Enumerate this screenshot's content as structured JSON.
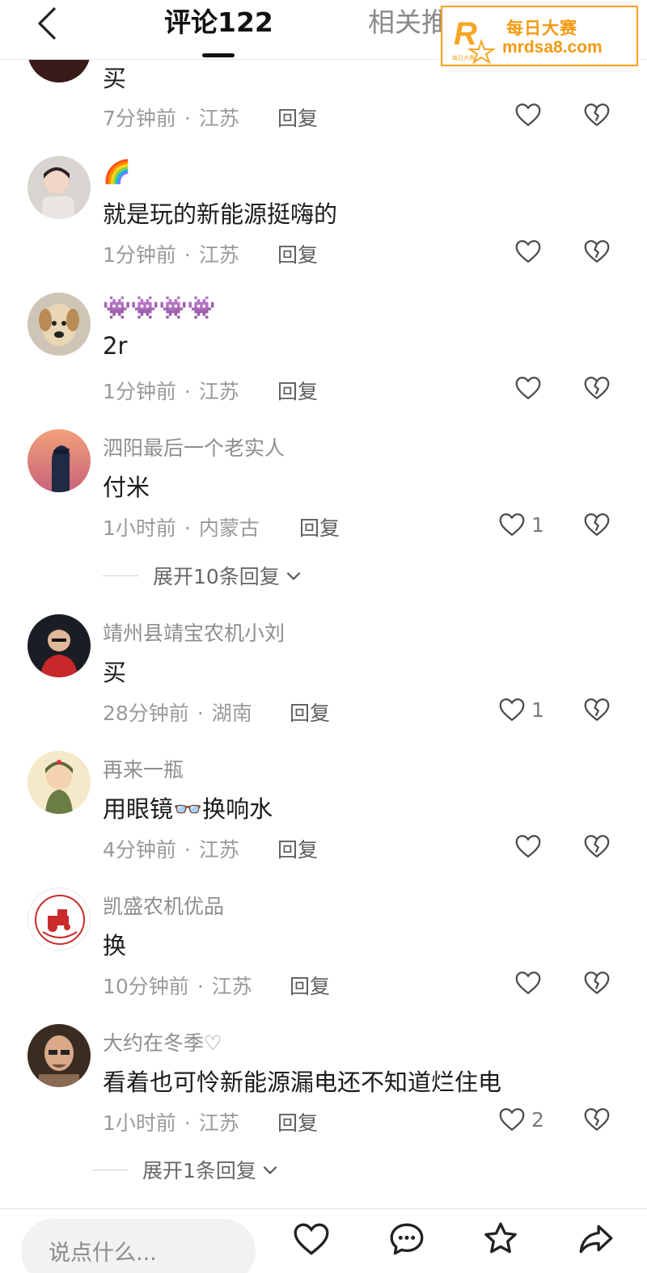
{
  "header": {
    "back_icon": "chevron-left-icon",
    "tab_comments": "评论122",
    "tab_related": "相关推荐"
  },
  "watermark": {
    "cn": "每日大赛",
    "url": "mrdsa8.com",
    "logo_letter": "R",
    "logo_small": "每日大赛",
    "color": "#f39a12"
  },
  "comments": [
    {
      "name": "",
      "text": "买",
      "time": "7分钟前",
      "location": "江苏",
      "reply": "回复",
      "likes": ""
    },
    {
      "name": "🌈",
      "text": "就是玩的新能源挺嗨的",
      "time": "1分钟前",
      "location": "江苏",
      "reply": "回复",
      "likes": ""
    },
    {
      "name": "👾👾👾👾",
      "text": "2r",
      "time": "1分钟前",
      "location": "江苏",
      "reply": "回复",
      "likes": ""
    },
    {
      "name": "泗阳最后一个老实人",
      "text": "付米",
      "time": "1小时前",
      "location": "内蒙古",
      "reply": "回复",
      "likes": "1",
      "expand": "展开10条回复"
    },
    {
      "name": "靖州县靖宝农机小刘",
      "text": "买",
      "time": "28分钟前",
      "location": "湖南",
      "reply": "回复",
      "likes": "1"
    },
    {
      "name": "再来一瓶",
      "text": "用眼镜👓换响水",
      "time": "4分钟前",
      "location": "江苏",
      "reply": "回复",
      "likes": ""
    },
    {
      "name": "凯盛农机优品",
      "text": "换",
      "time": "10分钟前",
      "location": "江苏",
      "reply": "回复",
      "likes": ""
    },
    {
      "name": "大约在冬季♡",
      "text": "看着也可怜新能源漏电还不知道烂住电",
      "time": "1小时前",
      "location": "江苏",
      "reply": "回复",
      "likes": "2",
      "expand": "展开1条回复"
    }
  ],
  "bottom_bar": {
    "placeholder": "说点什么...",
    "icons": [
      "heart-icon",
      "comment-icon",
      "star-icon",
      "share-icon"
    ]
  },
  "colors": {
    "accent": "#f39a12",
    "text": "#1b1b1b",
    "muted": "#9a9a9a"
  }
}
